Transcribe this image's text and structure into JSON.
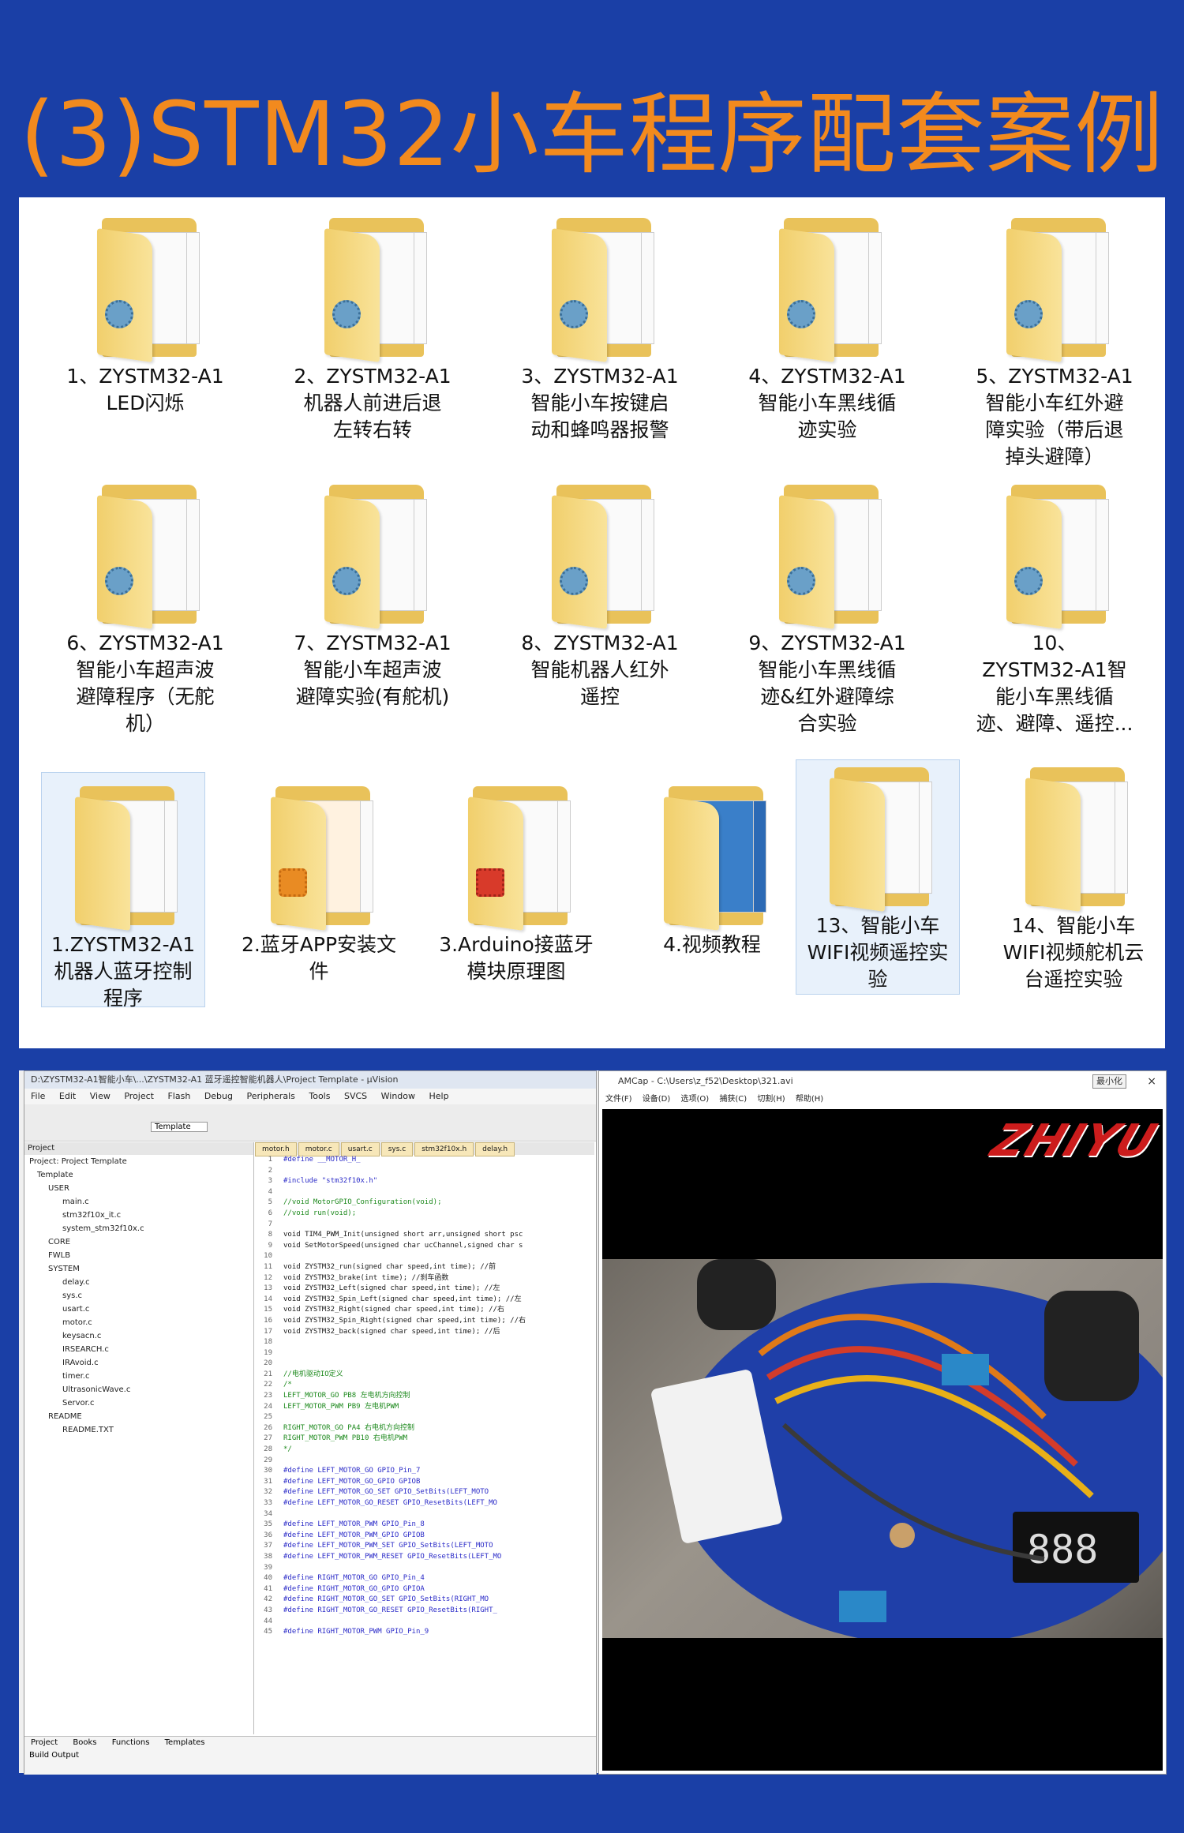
{
  "title": "(3)STM32小车程序配套案例",
  "folders_row1": [
    {
      "label": "1、ZYSTM32-A1\nLED闪烁"
    },
    {
      "label": "2、ZYSTM32-A1\n机器人前进后退\n左转右转"
    },
    {
      "label": "3、ZYSTM32-A1\n智能小车按键启\n动和蜂鸣器报警"
    },
    {
      "label": "4、ZYSTM32-A1\n智能小车黑线循\n迹实验"
    },
    {
      "label": "5、ZYSTM32-A1\n智能小车红外避\n障实验（带后退\n掉头避障）"
    }
  ],
  "folders_row2": [
    {
      "label": "6、ZYSTM32-A1\n智能小车超声波\n避障程序（无舵\n机）"
    },
    {
      "label": "7、ZYSTM32-A1\n智能小车超声波\n避障实验(有舵机)"
    },
    {
      "label": "8、ZYSTM32-A1\n智能机器人红外\n遥控"
    },
    {
      "label": "9、ZYSTM32-A1\n智能小车黑线循\n迹&红外避障综\n合实验"
    },
    {
      "label": "10、\nZYSTM32-A1智\n能小车黑线循\n迹、避障、遥控..."
    }
  ],
  "folders_row3": [
    {
      "label": "1.ZYSTM32-A1\n机器人蓝牙控制\n程序"
    },
    {
      "label": "2.蓝牙APP安装文\n件"
    },
    {
      "label": "3.Arduino接蓝牙\n模块原理图"
    },
    {
      "label": "4.视频教程"
    },
    {
      "label": "13、智能小车\nWIFI视频遥控实\n验"
    },
    {
      "label": "14、智能小车\nWIFI视频舵机云\n台遥控实验"
    }
  ],
  "ide": {
    "title": "D:\\ZYSTM32-A1智能小车\\...\\ZYSTM32-A1 蓝牙遥控智能机器人\\Project Template - µVision",
    "menus": [
      "File",
      "Edit",
      "View",
      "Project",
      "Flash",
      "Debug",
      "Peripherals",
      "Tools",
      "SVCS",
      "Window",
      "Help"
    ],
    "target": "Template",
    "tree_header": "Project",
    "tree": [
      "Project: Project Template",
      "Template",
      "USER",
      "main.c",
      "stm32f10x_it.c",
      "system_stm32f10x.c",
      "CORE",
      "FWLB",
      "SYSTEM",
      "delay.c",
      "sys.c",
      "usart.c",
      "motor.c",
      "keysacn.c",
      "IRSEARCH.c",
      "IRAvoid.c",
      "timer.c",
      "UltrasonicWave.c",
      "Servor.c",
      "README",
      "README.TXT"
    ],
    "tabs": [
      "motor.h",
      "motor.c",
      "usart.c",
      "sys.c",
      "stm32f10x.h",
      "delay.h"
    ],
    "code": [
      {
        "n": "1",
        "t": "#define __MOTOR_H_"
      },
      {
        "n": "2",
        "t": ""
      },
      {
        "n": "3",
        "t": "#include \"stm32f10x.h\""
      },
      {
        "n": "4",
        "t": ""
      },
      {
        "n": "5",
        "t": "//void MotorGPIO_Configuration(void);"
      },
      {
        "n": "6",
        "t": "//void run(void);"
      },
      {
        "n": "7",
        "t": ""
      },
      {
        "n": "8",
        "t": "void TIM4_PWM_Init(unsigned short arr,unsigned short psc"
      },
      {
        "n": "9",
        "t": "void SetMotorSpeed(unsigned char ucChannel,signed char s"
      },
      {
        "n": "10",
        "t": ""
      },
      {
        "n": "11",
        "t": "void ZYSTM32_run(signed char speed,int time);  //前"
      },
      {
        "n": "12",
        "t": "void ZYSTM32_brake(int time);        //刹车函数"
      },
      {
        "n": "13",
        "t": "void ZYSTM32_Left(signed char speed,int time);  //左"
      },
      {
        "n": "14",
        "t": "void ZYSTM32_Spin_Left(signed char speed,int time); //左"
      },
      {
        "n": "15",
        "t": "void ZYSTM32_Right(signed char speed,int time);  //右"
      },
      {
        "n": "16",
        "t": "void ZYSTM32_Spin_Right(signed char speed,int time); //右"
      },
      {
        "n": "17",
        "t": "void ZYSTM32_back(signed char speed,int time);  //后"
      },
      {
        "n": "18",
        "t": ""
      },
      {
        "n": "19",
        "t": ""
      },
      {
        "n": "20",
        "t": ""
      },
      {
        "n": "21",
        "t": "//电机驱动IO定义"
      },
      {
        "n": "22",
        "t": "/*"
      },
      {
        "n": "23",
        "t": "LEFT_MOTOR_GO    PB8 左电机方向控制"
      },
      {
        "n": "24",
        "t": "LEFT_MOTOR_PWM   PB9 左电机PWM"
      },
      {
        "n": "25",
        "t": ""
      },
      {
        "n": "26",
        "t": "RIGHT_MOTOR_GO   PA4  右电机方向控制"
      },
      {
        "n": "27",
        "t": "RIGHT_MOTOR_PWM  PB10  右电机PWM"
      },
      {
        "n": "28",
        "t": "*/"
      },
      {
        "n": "29",
        "t": ""
      },
      {
        "n": "30",
        "t": "#define LEFT_MOTOR_GO          GPIO_Pin_7"
      },
      {
        "n": "31",
        "t": "#define LEFT_MOTOR_GO_GPIO     GPIOB"
      },
      {
        "n": "32",
        "t": "#define LEFT_MOTOR_GO_SET      GPIO_SetBits(LEFT_MOTO"
      },
      {
        "n": "33",
        "t": "#define LEFT_MOTOR_GO_RESET    GPIO_ResetBits(LEFT_MO"
      },
      {
        "n": "34",
        "t": ""
      },
      {
        "n": "35",
        "t": "#define LEFT_MOTOR_PWM         GPIO_Pin_8"
      },
      {
        "n": "36",
        "t": "#define LEFT_MOTOR_PWM_GPIO    GPIOB"
      },
      {
        "n": "37",
        "t": "#define LEFT_MOTOR_PWM_SET     GPIO_SetBits(LEFT_MOTO"
      },
      {
        "n": "38",
        "t": "#define LEFT_MOTOR_PWM_RESET   GPIO_ResetBits(LEFT_MO"
      },
      {
        "n": "39",
        "t": ""
      },
      {
        "n": "40",
        "t": "#define RIGHT_MOTOR_GO         GPIO_Pin_4"
      },
      {
        "n": "41",
        "t": "#define RIGHT_MOTOR_GO_GPIO    GPIOA"
      },
      {
        "n": "42",
        "t": "#define RIGHT_MOTOR_GO_SET     GPIO_SetBits(RIGHT_MO"
      },
      {
        "n": "43",
        "t": "#define RIGHT_MOTOR_GO_RESET   GPIO_ResetBits(RIGHT_"
      },
      {
        "n": "44",
        "t": ""
      },
      {
        "n": "45",
        "t": "#define RIGHT_MOTOR_PWM        GPIO_Pin_9"
      }
    ],
    "bottom_tabs": [
      "Project",
      "Books",
      "Functions",
      "Templates"
    ],
    "build_output": "Build Output"
  },
  "amcap": {
    "title": "AMCap - C:\\Users\\z_f52\\Desktop\\321.avi",
    "menus": [
      "文件(F)",
      "设备(D)",
      "选项(O)",
      "捕获(C)",
      "切割(H)",
      "帮助(H)"
    ],
    "minimize": "最小化",
    "close": "×",
    "logo": "ZHIYU"
  },
  "colors": {
    "background": "#1a3fa6",
    "title": "#f28a1e"
  }
}
